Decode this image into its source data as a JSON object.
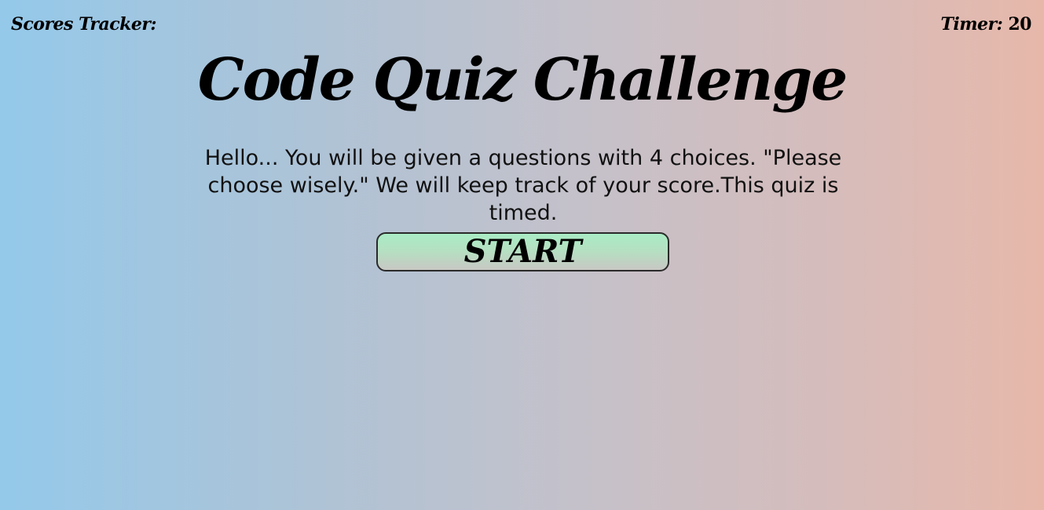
{
  "header": {
    "scores_label": "Scores Tracker:",
    "timer_label": "Timer:",
    "timer_value": "20"
  },
  "main": {
    "title": "Code Quiz Challenge",
    "intro": "Hello... You will be given a questions with 4 choices. \"Please choose wisely.\" We will keep track of your score.This quiz is timed.",
    "start_label": "START"
  },
  "colors": {
    "background_left": "#94c9ea",
    "background_right": "#e7b8aa",
    "button_top": "#a9ecc4",
    "button_bottom": "#c7c8c3",
    "text": "#000000"
  }
}
